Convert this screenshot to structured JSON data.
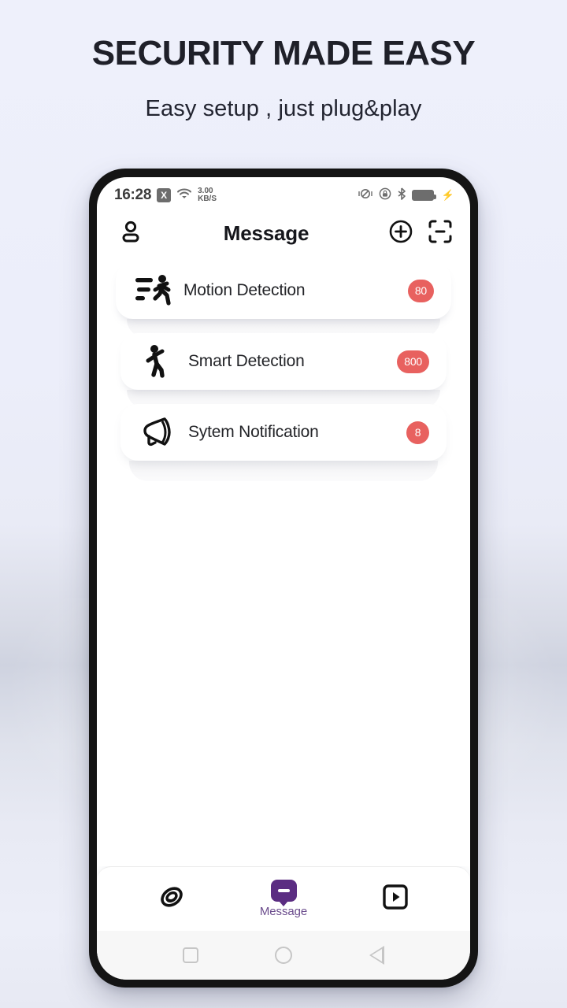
{
  "promo": {
    "title": "SECURITY MADE EASY",
    "subtitle": "Easy setup , just plug&play"
  },
  "colors": {
    "background": "#eef0fb",
    "badge": "#e8615f",
    "accent_purple": "#5b2d82",
    "nav_label": "#6a4b8c",
    "phone_frame": "#141414"
  },
  "phone": {
    "status_bar": {
      "time": "16:28",
      "x_badge": "X",
      "network_speed_value": "3.00",
      "network_speed_unit": "KB/S",
      "icons": [
        "wifi-icon",
        "vibrate-icon",
        "rotation-lock-icon",
        "bluetooth-icon",
        "battery-icon",
        "charging-bolt-icon"
      ]
    },
    "app_bar": {
      "title": "Message",
      "profile_icon": "person-icon",
      "add_icon": "plus-circle-icon",
      "scan_icon": "scan-frame-icon"
    },
    "messages": [
      {
        "label": "Motion Detection",
        "badge": "80",
        "icon": "running-person-icon"
      },
      {
        "label": "Smart Detection",
        "badge": "800",
        "icon": "walking-person-icon"
      },
      {
        "label": "Sytem Notification",
        "badge": "8",
        "icon": "megaphone-icon"
      }
    ],
    "bottom_nav": [
      {
        "label": "",
        "icon": "spiral-camera-icon",
        "active": false
      },
      {
        "label": "Message",
        "icon": "chat-bubble-icon",
        "active": true
      },
      {
        "label": "",
        "icon": "play-square-icon",
        "active": false
      }
    ],
    "android_nav": [
      "recents-square-icon",
      "home-circle-icon",
      "back-triangle-icon"
    ]
  }
}
